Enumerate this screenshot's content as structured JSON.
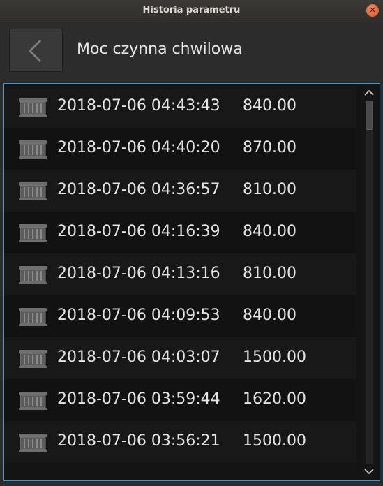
{
  "window": {
    "title": "Historia parametru",
    "close_icon": "close-icon"
  },
  "header": {
    "back_icon": "chevron-left-icon",
    "title": "Moc czynna chwilowa"
  },
  "list": {
    "row_icon": "meter-icon",
    "rows": [
      {
        "timestamp": "2018-07-06 04:43:43",
        "value": "840.00"
      },
      {
        "timestamp": "2018-07-06 04:40:20",
        "value": "870.00"
      },
      {
        "timestamp": "2018-07-06 04:36:57",
        "value": "810.00"
      },
      {
        "timestamp": "2018-07-06 04:16:39",
        "value": "840.00"
      },
      {
        "timestamp": "2018-07-06 04:13:16",
        "value": "810.00"
      },
      {
        "timestamp": "2018-07-06 04:09:53",
        "value": "840.00"
      },
      {
        "timestamp": "2018-07-06 04:03:07",
        "value": "1500.00"
      },
      {
        "timestamp": "2018-07-06 03:59:44",
        "value": "1620.00"
      },
      {
        "timestamp": "2018-07-06 03:56:21",
        "value": "1500.00"
      }
    ],
    "scroll_position": 0.0,
    "visible_fraction": 0.08
  }
}
